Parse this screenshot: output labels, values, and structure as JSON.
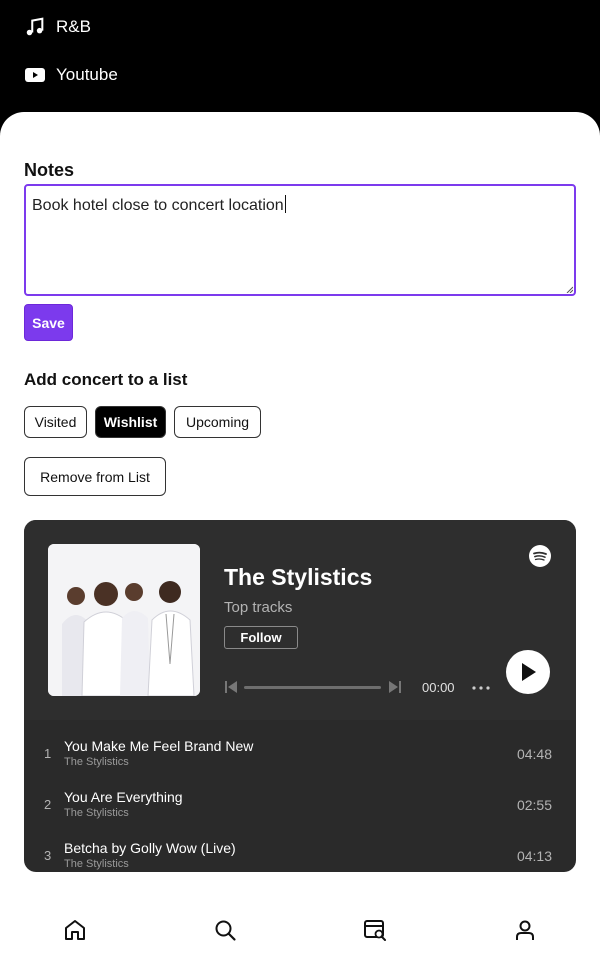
{
  "top_links": [
    {
      "label": "R&B",
      "icon": "music-note-icon"
    },
    {
      "label": "Youtube",
      "icon": "youtube-icon"
    }
  ],
  "notes": {
    "title": "Notes",
    "value": "Book hotel close to concert location",
    "save_label": "Save",
    "accent_color": "#7c3aed"
  },
  "lists": {
    "title": "Add concert to a list",
    "options": [
      {
        "label": "Visited",
        "selected": false
      },
      {
        "label": "Wishlist",
        "selected": true
      },
      {
        "label": "Upcoming",
        "selected": false
      }
    ],
    "remove_label": "Remove from List"
  },
  "spotify": {
    "artist": "The Stylistics",
    "subtitle": "Top tracks",
    "follow_label": "Follow",
    "time": "00:00",
    "progress": 0,
    "tracks": [
      {
        "num": "1",
        "name": "You Make Me Feel Brand New",
        "artist": "The Stylistics",
        "duration": "04:48"
      },
      {
        "num": "2",
        "name": "You Are Everything",
        "artist": "The Stylistics",
        "duration": "02:55"
      },
      {
        "num": "3",
        "name": "Betcha by Golly Wow (Live)",
        "artist": "The Stylistics",
        "duration": "04:13"
      }
    ]
  },
  "nav": [
    {
      "icon": "home-icon"
    },
    {
      "icon": "search-icon"
    },
    {
      "icon": "browse-events-icon"
    },
    {
      "icon": "profile-icon"
    }
  ]
}
